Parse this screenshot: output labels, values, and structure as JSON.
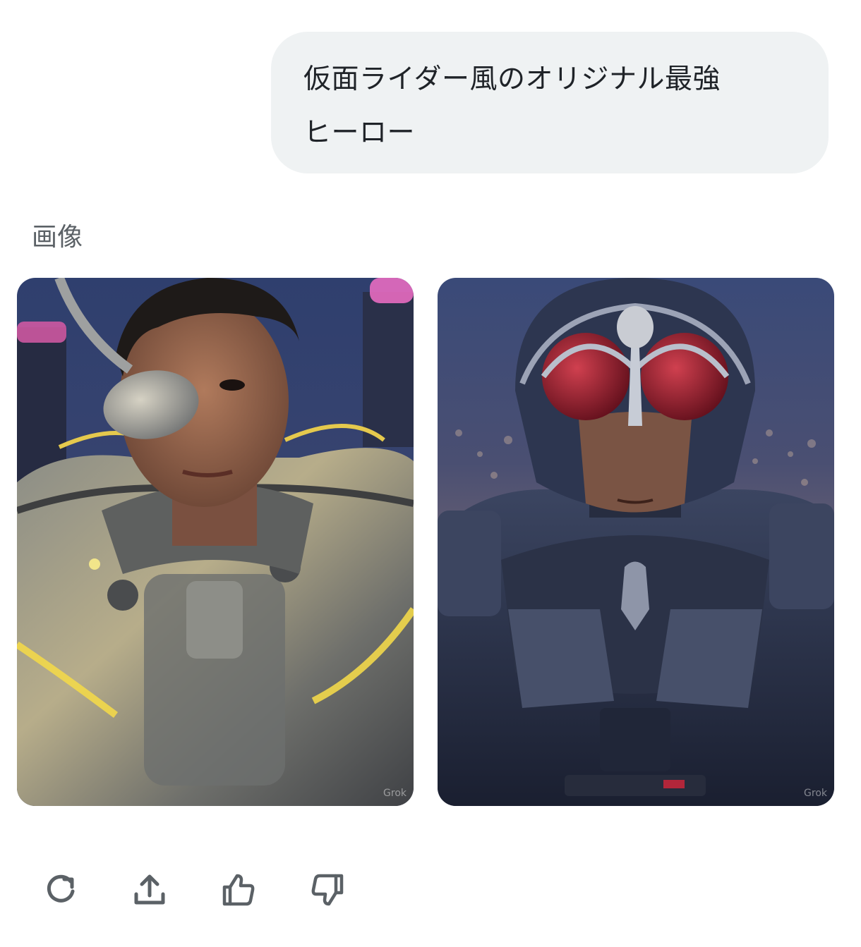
{
  "user_message": {
    "line1": "仮面ライダー風のオリジナル最強",
    "line2": "ヒーロー"
  },
  "images_section": {
    "label": "画像",
    "images": [
      {
        "watermark": "Grok"
      },
      {
        "watermark": "Grok"
      }
    ]
  },
  "actions": [
    {
      "icon": "regenerate-icon"
    },
    {
      "icon": "share-icon"
    },
    {
      "icon": "thumbs-up-icon"
    },
    {
      "icon": "thumbs-down-icon"
    }
  ],
  "colors": {
    "bubble_bg": "#eff2f3",
    "icon": "#5b6166",
    "label": "#5b6166"
  }
}
